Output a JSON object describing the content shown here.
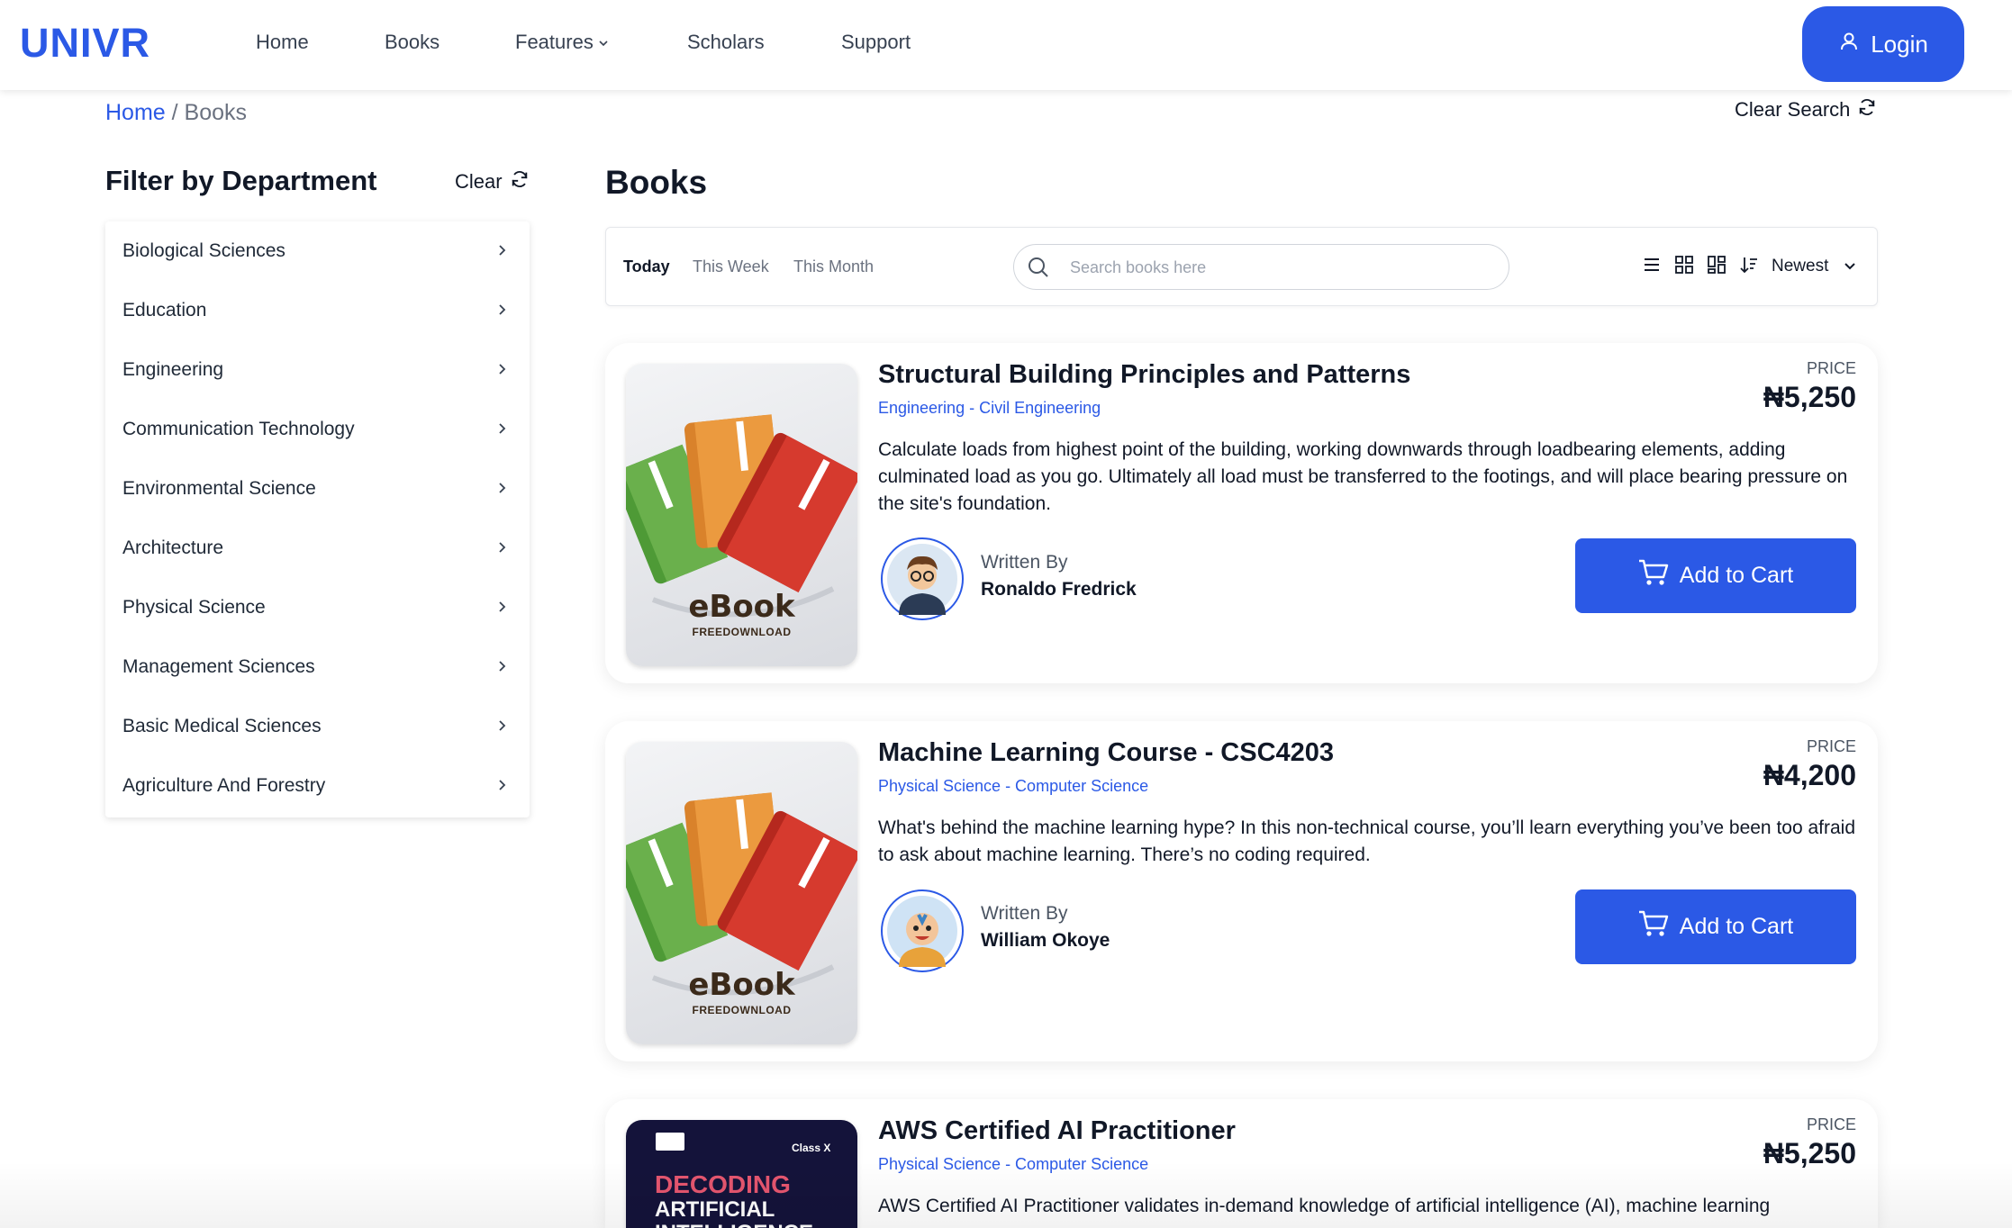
{
  "header": {
    "logo": "UNIVR",
    "nav": [
      {
        "label": "Home"
      },
      {
        "label": "Books"
      },
      {
        "label": "Features"
      },
      {
        "label": "Scholars"
      },
      {
        "label": "Support"
      }
    ],
    "login_label": "Login"
  },
  "breadcrumb": {
    "home": "Home",
    "separator": "/",
    "current": "Books"
  },
  "clear_search_label": "Clear Search",
  "sidebar": {
    "title": "Filter by Department",
    "clear_label": "Clear",
    "departments": [
      "Biological Sciences",
      "Education",
      "Engineering",
      "Communication Technology",
      "Environmental Science",
      "Architecture",
      "Physical Science",
      "Management Sciences",
      "Basic Medical Sciences",
      "Agriculture And Forestry"
    ]
  },
  "main": {
    "title": "Books",
    "tabs": [
      {
        "label": "Today",
        "active": true
      },
      {
        "label": "This Week",
        "active": false
      },
      {
        "label": "This Month",
        "active": false
      }
    ],
    "search": {
      "placeholder": "Search books here",
      "value": ""
    },
    "sort": {
      "selected": "Newest"
    },
    "view_icons": [
      "list-view-icon",
      "grid-view-icon",
      "masonry-view-icon",
      "sort-icon"
    ]
  },
  "books": [
    {
      "title": "Structural Building Principles and Patterns",
      "department": "Engineering - Civil Engineering",
      "price_label": "PRICE",
      "price": "₦5,250",
      "description": "Calculate loads from highest point of the building, working downwards through loadbearing elements, adding culminated load as you go. Ultimately all load must be transferred to the footings, and will place bearing pressure on the site's foundation.",
      "written_by_label": "Written By",
      "author": "Ronaldo Fredrick",
      "cart_label": "Add to Cart",
      "cover": {
        "word": "eBook",
        "sub": "FREEDOWNLOAD"
      }
    },
    {
      "title": "Machine Learning Course - CSC4203",
      "department": "Physical Science - Computer Science",
      "price_label": "PRICE",
      "price": "₦4,200",
      "description": "What's behind the machine learning hype? In this non-technical course, you’ll learn everything you’ve been too afraid to ask about machine learning. There’s no coding required.",
      "written_by_label": "Written By",
      "author": "William Okoye",
      "cart_label": "Add to Cart",
      "cover": {
        "word": "eBook",
        "sub": "FREEDOWNLOAD"
      }
    },
    {
      "title": "AWS Certified AI Practitioner",
      "department": "Physical Science - Computer Science",
      "price_label": "PRICE",
      "price": "₦5,250",
      "description": "AWS Certified AI Practitioner validates in-demand knowledge of artificial intelligence (AI), machine learning",
      "cover": {
        "badge": "Class X",
        "line1": "DECODING",
        "line2": "ARTIFICIAL",
        "line3": "INTELLIGENCE"
      }
    }
  ],
  "colors": {
    "accent": "#2b59e6",
    "text": "#111827",
    "muted": "#6b7280"
  }
}
